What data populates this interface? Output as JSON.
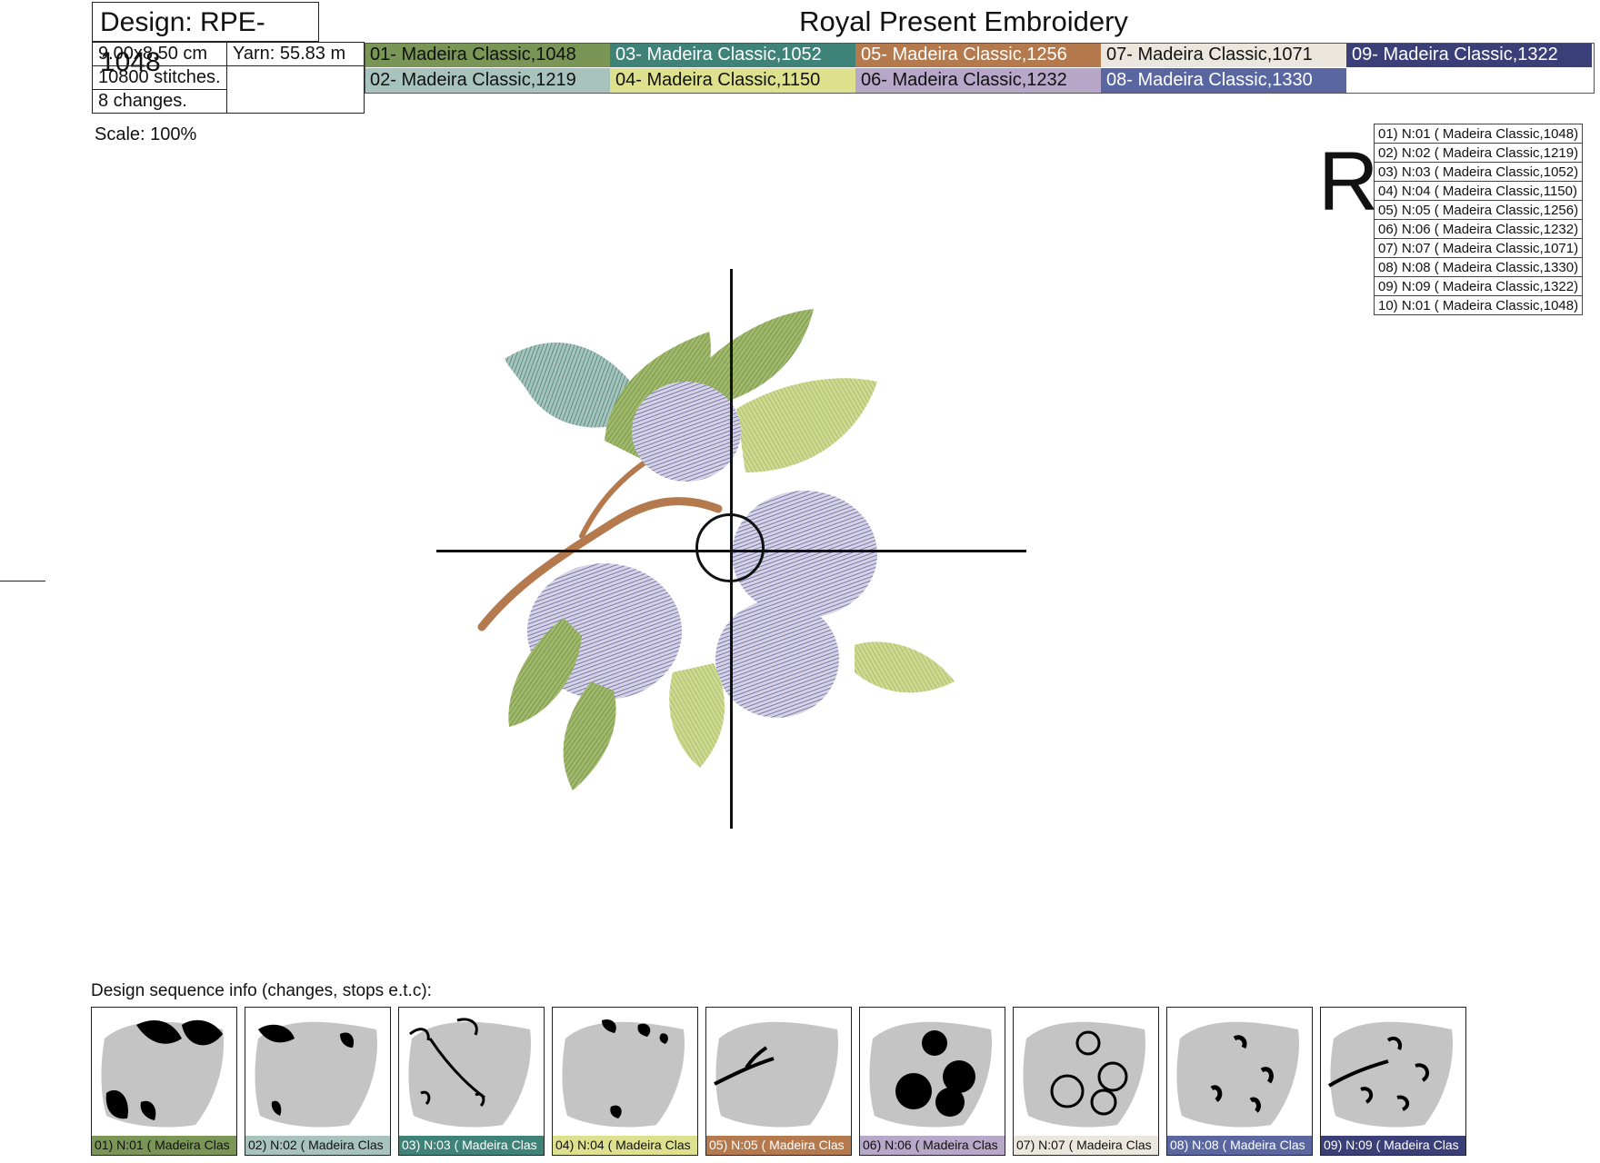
{
  "header": {
    "design_title": "Design: RPE-1048",
    "brand": "Royal Present Embroidery",
    "size": "9.00x8.50 cm",
    "yarn": "Yarn: 55.83 m",
    "stitches": "10800 stitches.",
    "changes": "8 changes.",
    "scale": "Scale: 100%",
    "rotation_mark": "R"
  },
  "colors": [
    {
      "label": "01- Madeira Classic,1048",
      "color": "#7a9656",
      "text": "#111111"
    },
    {
      "label": "02- Madeira Classic,1219",
      "color": "#a7c3bb",
      "text": "#111111"
    },
    {
      "label": "03- Madeira Classic,1052",
      "color": "#3f8277",
      "text": "#ffffff"
    },
    {
      "label": "04- Madeira Classic,1150",
      "color": "#dde08c",
      "text": "#111111"
    },
    {
      "label": "05- Madeira Classic,1256",
      "color": "#b4794d",
      "text": "#ffffff"
    },
    {
      "label": "06- Madeira Classic,1232",
      "color": "#b7a7c8",
      "text": "#111111"
    },
    {
      "label": "07- Madeira Classic,1071",
      "color": "#ebe7df",
      "text": "#111111"
    },
    {
      "label": "08- Madeira Classic,1330",
      "color": "#5966a0",
      "text": "#ffffff"
    },
    {
      "label": "09- Madeira Classic,1322",
      "color": "#3b3f78",
      "text": "#ffffff"
    }
  ],
  "sequence": [
    "01) N:01 ( Madeira Classic,1048)",
    "02) N:02 ( Madeira Classic,1219)",
    "03) N:03 ( Madeira Classic,1052)",
    "04) N:04 ( Madeira Classic,1150)",
    "05) N:05 ( Madeira Classic,1256)",
    "06) N:06 ( Madeira Classic,1232)",
    "07) N:07 ( Madeira Classic,1071)",
    "08) N:08 ( Madeira Classic,1330)",
    "09) N:09 ( Madeira Classic,1322)",
    "10) N:01 ( Madeira Classic,1048)"
  ],
  "sequence_info_label": "Design sequence info (changes, stops e.t.c):",
  "thumbnails": [
    "01) N:01 ( Madeira Clas",
    "02) N:02 ( Madeira Clas",
    "03) N:03 ( Madeira Clas",
    "04) N:04 ( Madeira Clas",
    "05) N:05 ( Madeira Clas",
    "06) N:06 ( Madeira Clas",
    "07) N:07 ( Madeira Clas",
    "08) N:08 ( Madeira Clas",
    "09) N:09 ( Madeira Clas"
  ]
}
